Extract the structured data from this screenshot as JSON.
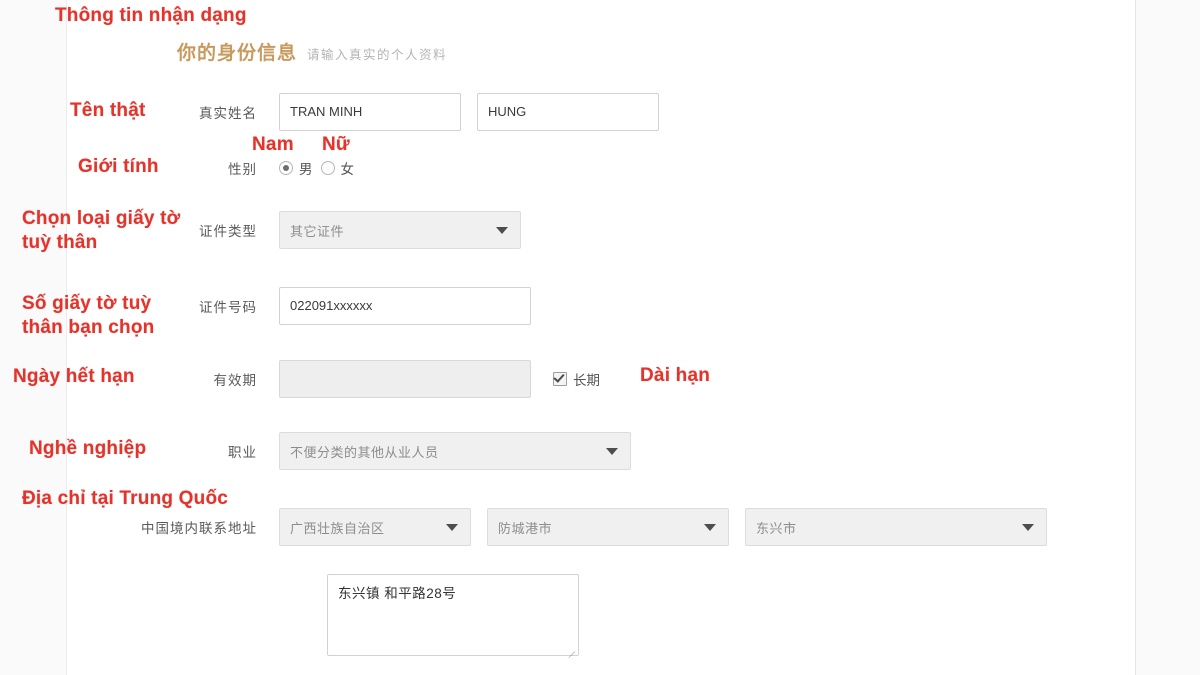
{
  "page": {
    "accent_red": "#e3342c",
    "heading_gold": "#c79a5d"
  },
  "form": {
    "heading": {
      "title": "你的身份信息",
      "subtitle": "请输入真实的个人资料"
    },
    "fields": {
      "real_name": {
        "label": "真实姓名",
        "first_value": "TRAN MINH",
        "last_value": "HUNG"
      },
      "gender": {
        "label": "性别",
        "options": [
          "男",
          "女"
        ],
        "selected": "男"
      },
      "id_type": {
        "label": "证件类型",
        "value": "其它证件"
      },
      "id_number": {
        "label": "证件号码",
        "value": "022091xxxxxx"
      },
      "validity": {
        "label": "有效期",
        "value": "",
        "long_term_label": "长期",
        "long_term_checked": true
      },
      "occupation": {
        "label": "职业",
        "value": "不便分类的其他从业人员"
      },
      "address": {
        "label": "中国境内联系地址",
        "province": "广西壮族自治区",
        "city": "防城港市",
        "district": "东兴市",
        "detail": "东兴镇 和平路28号"
      }
    }
  },
  "annotations": {
    "section_title": "Thông tin nhận dạng",
    "real_name": "Tên thật",
    "gender": "Giới tính",
    "gender_male": "Nam",
    "gender_female": "Nữ",
    "id_type": "Chọn loại giấy tờ\ntuỳ thân",
    "id_number": "Số giấy tờ tuỳ\nthân bạn chọn",
    "validity": "Ngày hết hạn",
    "long_term": "Dài hạn",
    "occupation": "Nghề nghiệp",
    "address": "Địa chỉ tại Trung Quốc"
  }
}
